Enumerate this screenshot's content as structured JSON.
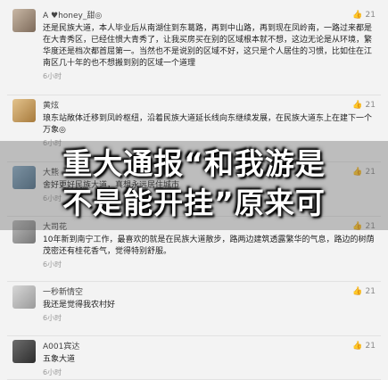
{
  "posts": [
    {
      "user": "A ♥honey_甜◎",
      "likes": "21",
      "text": "还是民族大道，本人毕业后从南湖住到东葛路，再到中山路，再到现在凤岭南，一路过来都是在大青秀区，已经住惯大青秀了，让我买房买在别的区域根本就不想，这边无论是从环境，繁华度还是档次都首屈第一。当然也不是说别的区域不好，这只是个人居住的习惯，比如住在江南区几十年的也不想搬到别的区域一个道理",
      "time": "6小时"
    },
    {
      "user": "黄炫",
      "likes": "21",
      "text": "琅东站敞体迁移到凤岭枢纽，沿着民族大道延长线向东继续发展，在民族大道东上在建下一个万象◎",
      "time": "6小时"
    },
    {
      "user": "大熊",
      "likes": "21",
      "text": "舍好更好民族大道，真想永远居住城市",
      "time": "6小时"
    },
    {
      "user": "大司花",
      "likes": "21",
      "text": "10年新到南宁工作，最喜欢的就是在民族大道散步，路两边建筑透露繁华的气息，路边的树荫茂密还有桂花香气，觉得特别舒服。",
      "time": "6小时"
    },
    {
      "user": "一秒新情空",
      "likes": "21",
      "text": "我还是觉得我农村好",
      "time": "6小时"
    },
    {
      "user": "A001宾达",
      "likes": "21",
      "text": "五象大道",
      "time": "6小时"
    }
  ],
  "overlay": {
    "line1": "重大通报“和我游是",
    "line2": "不是能开挂”原来可"
  },
  "icons": {
    "like": "thumbs-up-icon"
  }
}
